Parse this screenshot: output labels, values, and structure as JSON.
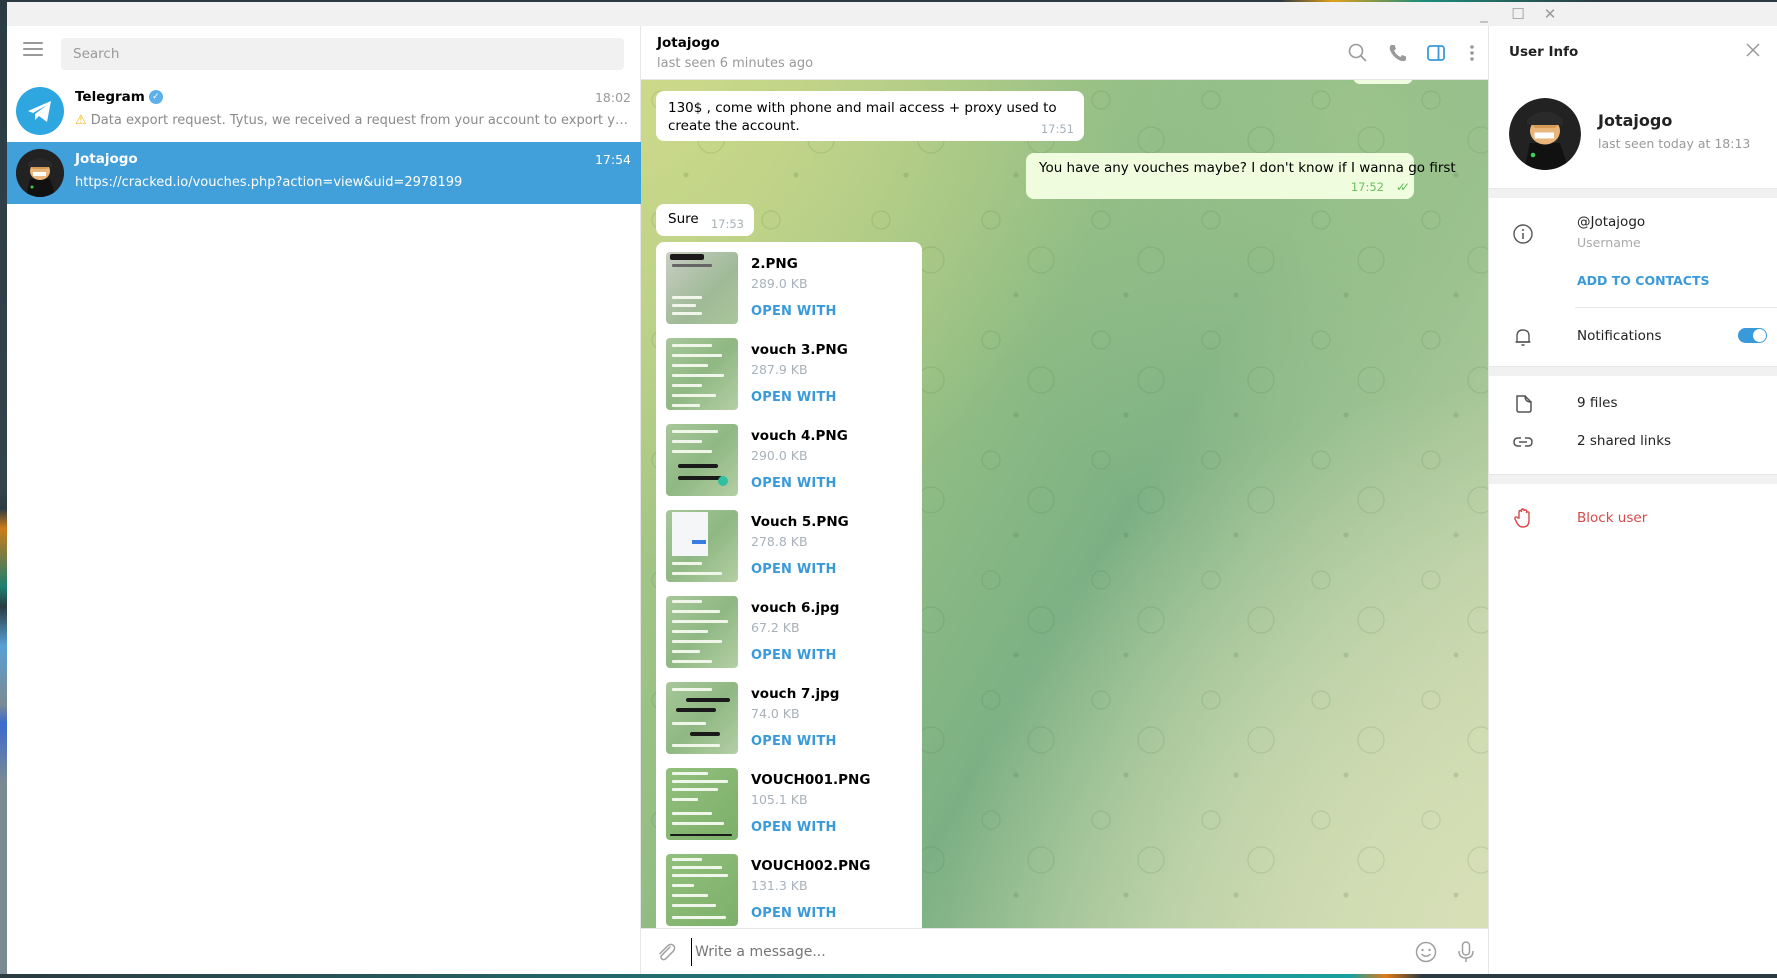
{
  "window": {
    "controls": {
      "minimize": "_",
      "maximize": "☐",
      "close": "✕"
    }
  },
  "sidebar": {
    "search_placeholder": "Search",
    "chats": [
      {
        "name": "Telegram",
        "verified": true,
        "time": "18:02",
        "preview_icon": "⚠️",
        "preview": "Data export request. Tytus, we received a request from your account to export your Te...",
        "selected": false
      },
      {
        "name": "Jotajogo",
        "verified": false,
        "time": "17:54",
        "preview": "https://cracked.io/vouches.php?action=view&uid=2978199",
        "selected": true
      }
    ]
  },
  "chat": {
    "title": "Jotajogo",
    "status": "last seen 6 minutes ago",
    "header_icons": [
      "search-icon",
      "phone-icon",
      "sidebar-toggle-icon",
      "more-vertical-icon"
    ],
    "messages": [
      {
        "direction": "in",
        "text": "130$ , come with phone and mail access + proxy used to create the account.",
        "time": "17:51"
      },
      {
        "direction": "out",
        "text": "You have any vouches maybe? I don't know if I wanna go first",
        "time": "17:52",
        "read": true
      },
      {
        "direction": "in",
        "text": "Sure",
        "time": "17:53"
      }
    ],
    "files": [
      {
        "name": "2.PNG",
        "size": "289.0 KB",
        "action": "OPEN WITH"
      },
      {
        "name": "vouch 3.PNG",
        "size": "287.9 KB",
        "action": "OPEN WITH"
      },
      {
        "name": "vouch 4.PNG",
        "size": "290.0 KB",
        "action": "OPEN WITH"
      },
      {
        "name": "Vouch 5.PNG",
        "size": "278.8 KB",
        "action": "OPEN WITH"
      },
      {
        "name": "vouch 6.jpg",
        "size": "67.2 KB",
        "action": "OPEN WITH"
      },
      {
        "name": "vouch 7.jpg",
        "size": "74.0 KB",
        "action": "OPEN WITH"
      },
      {
        "name": "VOUCH001.PNG",
        "size": "105.1 KB",
        "action": "OPEN WITH"
      },
      {
        "name": "VOUCH002.PNG",
        "size": "131.3 KB",
        "action": "OPEN WITH"
      }
    ],
    "input_placeholder": "Write a message..."
  },
  "user_info": {
    "header": "User Info",
    "name": "Jotajogo",
    "status": "last seen today at 18:13",
    "username": "@Jotajogo",
    "username_label": "Username",
    "add_contacts": "ADD TO CONTACTS",
    "notifications_label": "Notifications",
    "notifications_on": true,
    "files_count": "9 files",
    "shared_links": "2 shared links",
    "block_user": "Block user"
  },
  "colors": {
    "accent": "#419fd9",
    "link": "#3a9ad9",
    "danger": "#d8494b",
    "outgoing_bubble": "#effdde",
    "read_check": "#5fbb55"
  }
}
